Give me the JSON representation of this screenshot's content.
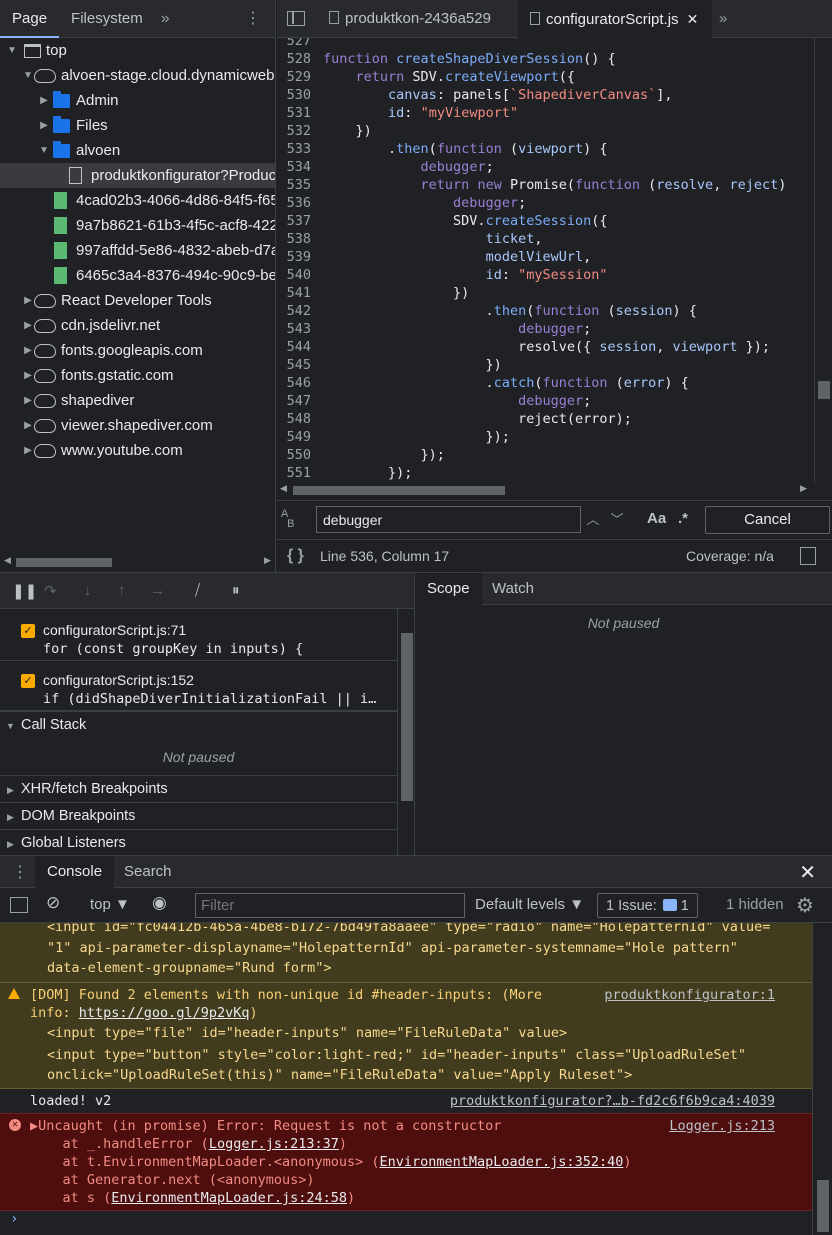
{
  "navigator": {
    "tabs": [
      {
        "label": "Page"
      },
      {
        "label": "Filesystem"
      }
    ],
    "more": "»",
    "tree": [
      {
        "label": "top",
        "level": 0,
        "icon": "frame",
        "arrow": "▼"
      },
      {
        "label": "alvoen-stage.cloud.dynamicweb-cms.com",
        "level": 1,
        "icon": "cloud",
        "arrow": "▼"
      },
      {
        "label": "Admin",
        "level": 2,
        "icon": "folder",
        "arrow": "▶"
      },
      {
        "label": "Files",
        "level": 2,
        "icon": "folder",
        "arrow": "▶"
      },
      {
        "label": "alvoen",
        "level": 2,
        "icon": "folder",
        "arrow": "▼"
      },
      {
        "label": "produktkonfigurator?ProductId=",
        "level": 3,
        "icon": "file-white",
        "arrow": "",
        "selected": true
      },
      {
        "label": "4cad02b3-4066-4d86-84f5-f65",
        "level": 2,
        "icon": "file-green",
        "arrow": ""
      },
      {
        "label": "9a7b8621-61b3-4f5c-acf8-422",
        "level": 2,
        "icon": "file-green",
        "arrow": ""
      },
      {
        "label": "997affdd-5e86-4832-abeb-d7a",
        "level": 2,
        "icon": "file-green",
        "arrow": ""
      },
      {
        "label": "6465c3a4-8376-494c-90c9-be",
        "level": 2,
        "icon": "file-green",
        "arrow": ""
      },
      {
        "label": "React Developer Tools",
        "level": 1,
        "icon": "cloud",
        "arrow": "▶"
      },
      {
        "label": "cdn.jsdelivr.net",
        "level": 1,
        "icon": "cloud",
        "arrow": "▶"
      },
      {
        "label": "fonts.googleapis.com",
        "level": 1,
        "icon": "cloud",
        "arrow": "▶"
      },
      {
        "label": "fonts.gstatic.com",
        "level": 1,
        "icon": "cloud",
        "arrow": "▶"
      },
      {
        "label": "shapediver",
        "level": 1,
        "icon": "cloud",
        "arrow": "▶"
      },
      {
        "label": "viewer.shapediver.com",
        "level": 1,
        "icon": "cloud",
        "arrow": "▶"
      },
      {
        "label": "www.youtube.com",
        "level": 1,
        "icon": "cloud",
        "arrow": "▶"
      }
    ]
  },
  "editor": {
    "tabs": [
      {
        "label": "produktkon-2436a529",
        "active": false
      },
      {
        "label": "configuratorScript.js",
        "active": true,
        "close": "✕"
      }
    ],
    "more": "»",
    "lines": [
      {
        "n": "527",
        "t": [
          [
            "",
            ""
          ]
        ]
      },
      {
        "n": "528",
        "t": [
          [
            "kw",
            "function "
          ],
          [
            "fn",
            "createShapeDiverSession"
          ],
          [
            "tx",
            "() {"
          ]
        ]
      },
      {
        "n": "529",
        "t": [
          [
            "tx",
            "    "
          ],
          [
            "kw",
            "return "
          ],
          [
            "tx",
            "SDV."
          ],
          [
            "fn",
            "createViewport"
          ],
          [
            "tx",
            "({"
          ]
        ]
      },
      {
        "n": "530",
        "t": [
          [
            "tx",
            "        "
          ],
          [
            "pm",
            "canvas"
          ],
          [
            "tx",
            ": panels["
          ],
          [
            "st",
            "`ShapediverCanvas`"
          ],
          [
            "tx",
            "],"
          ]
        ]
      },
      {
        "n": "531",
        "t": [
          [
            "tx",
            "        "
          ],
          [
            "pm",
            "id"
          ],
          [
            "tx",
            ": "
          ],
          [
            "st",
            "\"myViewport\""
          ]
        ]
      },
      {
        "n": "532",
        "t": [
          [
            "tx",
            "    })"
          ]
        ]
      },
      {
        "n": "533",
        "t": [
          [
            "tx",
            "        ."
          ],
          [
            "fn",
            "then"
          ],
          [
            "tx",
            "("
          ],
          [
            "kw",
            "function "
          ],
          [
            "tx",
            "("
          ],
          [
            "pm",
            "viewport"
          ],
          [
            "tx",
            ") {"
          ]
        ]
      },
      {
        "n": "534",
        "t": [
          [
            "tx",
            "            "
          ],
          [
            "kw",
            "debugger"
          ],
          [
            "tx",
            ";"
          ]
        ]
      },
      {
        "n": "535",
        "t": [
          [
            "tx",
            "            "
          ],
          [
            "kw",
            "return new "
          ],
          [
            "tx",
            "Promise("
          ],
          [
            "kw",
            "function "
          ],
          [
            "tx",
            "("
          ],
          [
            "pm",
            "resolve"
          ],
          [
            "tx",
            ", "
          ],
          [
            "pm",
            "reject"
          ],
          [
            "tx",
            ")"
          ]
        ]
      },
      {
        "n": "536",
        "t": [
          [
            "tx",
            "                "
          ],
          [
            "kw",
            "debugger"
          ],
          [
            "tx",
            ";"
          ]
        ]
      },
      {
        "n": "537",
        "t": [
          [
            "tx",
            "                SDV."
          ],
          [
            "fn",
            "createSession"
          ],
          [
            "tx",
            "({"
          ]
        ]
      },
      {
        "n": "538",
        "t": [
          [
            "tx",
            "                    "
          ],
          [
            "pm",
            "ticket"
          ],
          [
            "tx",
            ","
          ]
        ]
      },
      {
        "n": "539",
        "t": [
          [
            "tx",
            "                    "
          ],
          [
            "pm",
            "modelViewUrl"
          ],
          [
            "tx",
            ","
          ]
        ]
      },
      {
        "n": "540",
        "t": [
          [
            "tx",
            "                    "
          ],
          [
            "pm",
            "id"
          ],
          [
            "tx",
            ": "
          ],
          [
            "st",
            "\"mySession\""
          ]
        ]
      },
      {
        "n": "541",
        "t": [
          [
            "tx",
            "                })"
          ]
        ]
      },
      {
        "n": "542",
        "t": [
          [
            "tx",
            "                    ."
          ],
          [
            "fn",
            "then"
          ],
          [
            "tx",
            "("
          ],
          [
            "kw",
            "function "
          ],
          [
            "tx",
            "("
          ],
          [
            "pm",
            "session"
          ],
          [
            "tx",
            ") {"
          ]
        ]
      },
      {
        "n": "543",
        "t": [
          [
            "tx",
            "                        "
          ],
          [
            "kw",
            "debugger"
          ],
          [
            "tx",
            ";"
          ]
        ]
      },
      {
        "n": "544",
        "t": [
          [
            "tx",
            "                        resolve({ "
          ],
          [
            "pm",
            "session"
          ],
          [
            "tx",
            ", "
          ],
          [
            "pm",
            "viewport"
          ],
          [
            "tx",
            " });"
          ]
        ]
      },
      {
        "n": "545",
        "t": [
          [
            "tx",
            "                    })"
          ]
        ]
      },
      {
        "n": "546",
        "t": [
          [
            "tx",
            "                    ."
          ],
          [
            "fn",
            "catch"
          ],
          [
            "tx",
            "("
          ],
          [
            "kw",
            "function "
          ],
          [
            "tx",
            "("
          ],
          [
            "pm",
            "error"
          ],
          [
            "tx",
            ") {"
          ]
        ]
      },
      {
        "n": "547",
        "t": [
          [
            "tx",
            "                        "
          ],
          [
            "kw",
            "debugger"
          ],
          [
            "tx",
            ";"
          ]
        ]
      },
      {
        "n": "548",
        "t": [
          [
            "tx",
            "                        reject(error);"
          ]
        ]
      },
      {
        "n": "549",
        "t": [
          [
            "tx",
            "                    });"
          ]
        ]
      },
      {
        "n": "550",
        "t": [
          [
            "tx",
            "            });"
          ]
        ]
      },
      {
        "n": "551",
        "t": [
          [
            "tx",
            "        });"
          ]
        ]
      }
    ],
    "search": {
      "value": "debugger",
      "match_case": "Aa",
      "regex": ".*",
      "cancel": "Cancel"
    },
    "status": {
      "position": "Line 536, Column 17",
      "coverage": "Coverage: n/a"
    }
  },
  "debugger": {
    "breakpoints": [
      {
        "file": "configuratorScript.js:71",
        "code": "for (const groupKey in inputs) {"
      },
      {
        "file": "configuratorScript.js:152",
        "code": "if (didShapeDiverInitializationFail || i…"
      }
    ],
    "sections": {
      "call_stack": "Call Stack",
      "not_paused": "Not paused",
      "xhr": "XHR/fetch Breakpoints",
      "dom": "DOM Breakpoints",
      "global": "Global Listeners"
    },
    "scope_tabs": [
      {
        "label": "Scope"
      },
      {
        "label": "Watch"
      }
    ],
    "scope_not_paused": "Not paused"
  },
  "drawer": {
    "tabs": [
      {
        "label": "Console"
      },
      {
        "label": "Search"
      }
    ],
    "context": "top",
    "filter_placeholder": "Filter",
    "levels": "Default levels ▼",
    "issues": {
      "prefix": "1 Issue:",
      "count": "1"
    },
    "hidden": "1 hidden"
  },
  "console": {
    "warn1": {
      "line1": "<input id=\"fc04412b-465a-4be8-b172-7bd49fa8aaee\" type=\"radio\" name=\"HolepatternId\" value=",
      "line2": "\"1\" api-parameter-displayname=\"HolepatternId\" api-parameter-systemname=\"Hole pattern\"",
      "line3": "data-element-groupname=\"Rund form\">"
    },
    "warn2": {
      "msg1": "[DOM] Found 2 elements with non-unique id #header-inputs: (More",
      "msg2_pre": "info: ",
      "msg2_link": "https://goo.gl/9p2vKq",
      "msg2_post": ")",
      "source": "produktkonfigurator:1",
      "line3": "<input type=\"file\" id=\"header-inputs\" name=\"FileRuleData\" value>",
      "line4": "<input type=\"button\" style=\"color:light-red;\" id=\"header-inputs\" class=\"UploadRuleSet\"",
      "line5": "onclick=\"UploadRuleSet(this)\" name=\"FileRuleData\" value=\"Apply Ruleset\">"
    },
    "log1": {
      "msg": "loaded! v2",
      "source": "produktkonfigurator?…b-fd2c6f6b9ca4:4039"
    },
    "error": {
      "msg": "▶Uncaught (in promise) Error: Request is not a constructor",
      "source": "Logger.js:213",
      "stack": [
        {
          "pre": "    at _.handleError (",
          "link": "Logger.js:213:37",
          "post": ")"
        },
        {
          "pre": "    at t.EnvironmentMapLoader.<anonymous> (",
          "link": "EnvironmentMapLoader.js:352:40",
          "post": ")"
        },
        {
          "pre": "    at Generator.next (<anonymous>)",
          "link": "",
          "post": ""
        },
        {
          "pre": "    at s (",
          "link": "EnvironmentMapLoader.js:24:58",
          "post": ")"
        }
      ]
    },
    "prompt": "›"
  }
}
